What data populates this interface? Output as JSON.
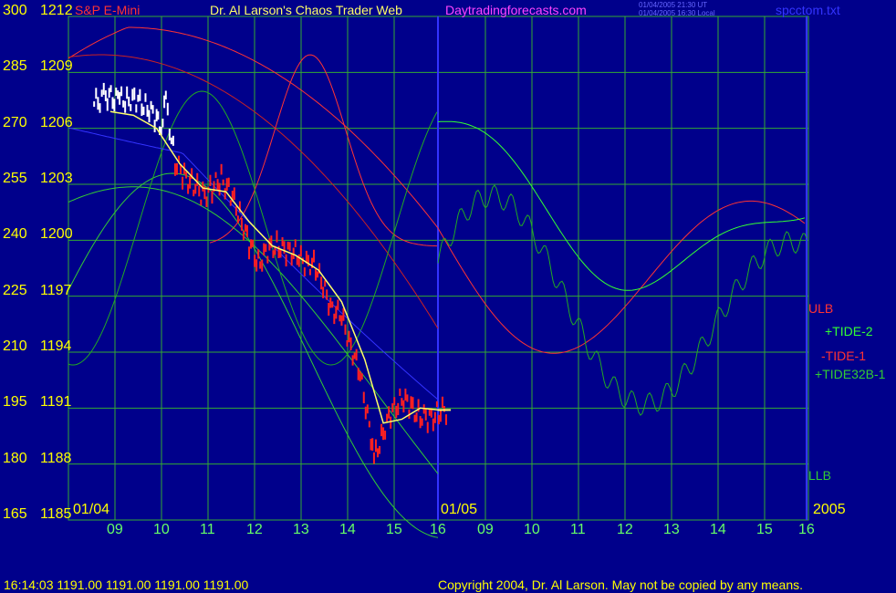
{
  "header": {
    "instrument": "S&P E-Mini",
    "title": "Dr. Al Larson's Chaos Trader Web",
    "site": "Daytradingforecasts.com",
    "ut_time": "01/04/2005 21:30 UT",
    "local_time": "01/04/2005 16:30 Local",
    "filename": "spcctom.txt"
  },
  "footer": {
    "quote": "16:14:03  1191.00 1191.00 1191.00 1191.00",
    "copyright": "Copyright 2004, Dr. Al Larson. May not be copied by any means."
  },
  "date_labels": {
    "left": "01/04",
    "middle": "01/05",
    "right": "2005"
  },
  "colors": {
    "background": "#00008b",
    "grid": "#33aa33",
    "axis_text": "#ffff00",
    "hour_text": "#66ff66",
    "price_bar": "#ff2020",
    "white_bars": "#ffffff",
    "moving_avg": "#ffff66",
    "ulb": "#ff3333",
    "tide": "#33cc33",
    "blue_line": "#3333ff"
  },
  "chart_data": {
    "type": "line",
    "y_left_ticks": [
      "300",
      "285",
      "270",
      "255",
      "240",
      "225",
      "210",
      "195",
      "180",
      "165"
    ],
    "y_right_ticks": [
      "1212",
      "1209",
      "1206",
      "1203",
      "1200",
      "1197",
      "1194",
      "1191",
      "1188",
      "1185"
    ],
    "x_ticks": [
      "09",
      "10",
      "11",
      "12",
      "13",
      "14",
      "15",
      "16",
      "09",
      "10",
      "11",
      "12",
      "13",
      "14",
      "15",
      "16"
    ],
    "ylim": [
      1185,
      1212
    ],
    "hours": [
      8.5,
      16.3
    ],
    "legend": [
      {
        "name": "ULB",
        "color": "#ff3333"
      },
      {
        "name": "+TIDE-2",
        "color": "#33ff33"
      },
      {
        "name": "-TIDE-1",
        "color": "#ff3333"
      },
      {
        "name": "+TIDE32B-1",
        "color": "#33cc33"
      },
      {
        "name": "LLB",
        "color": "#33cc33"
      }
    ],
    "price_series": {
      "name": "S&P E-Mini",
      "hour": [
        8.55,
        8.8,
        9.1,
        9.3,
        9.5,
        9.7,
        9.9,
        10.0,
        10.1,
        10.3,
        10.5,
        10.7,
        10.9,
        11.1,
        11.3,
        11.5,
        11.7,
        11.9,
        12.1,
        12.3,
        12.5,
        12.7,
        12.9,
        13.1,
        13.3,
        13.5,
        13.7,
        13.9,
        14.1,
        14.3,
        14.5,
        14.6,
        14.8,
        15.0,
        15.2,
        15.4,
        15.6,
        15.8,
        16.0,
        16.2
      ],
      "price": [
        1207.3,
        1207.8,
        1207.5,
        1207.6,
        1207.4,
        1207.2,
        1206.4,
        1206.2,
        1207.4,
        1204.2,
        1203.4,
        1203.0,
        1202.4,
        1202.8,
        1203.3,
        1202.5,
        1201.3,
        1199.8,
        1198.8,
        1199.4,
        1199.8,
        1199.3,
        1199.5,
        1198.6,
        1198.9,
        1197.4,
        1196.4,
        1195.8,
        1194.4,
        1192.7,
        1190.2,
        1188.2,
        1189.8,
        1190.8,
        1191.6,
        1191.0,
        1190.6,
        1190.4,
        1190.8,
        1190.9
      ]
    },
    "moving_average": {
      "name": "Average",
      "hour": [
        8.9,
        9.4,
        9.9,
        10.4,
        10.9,
        11.4,
        11.9,
        12.4,
        12.9,
        13.4,
        13.9,
        14.4,
        14.8,
        15.2,
        15.6,
        16.0,
        16.2
      ],
      "price": [
        1206.9,
        1206.7,
        1206.0,
        1204.1,
        1202.8,
        1202.6,
        1201.0,
        1199.7,
        1199.2,
        1198.4,
        1196.7,
        1193.6,
        1190.2,
        1190.4,
        1191.0,
        1190.9,
        1190.9
      ]
    }
  }
}
